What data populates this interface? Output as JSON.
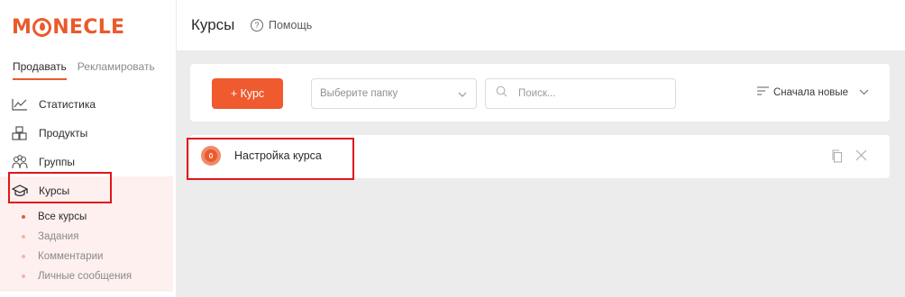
{
  "brand": {
    "logo_text": "MONECLE",
    "accent": "#ea5a2b"
  },
  "modes": [
    {
      "label": "Продавать",
      "active": true
    },
    {
      "label": "Рекламировать",
      "active": false
    }
  ],
  "sidebar": {
    "items": [
      {
        "label": "Статистика",
        "icon": "chart-line-icon"
      },
      {
        "label": "Продукты",
        "icon": "boxes-icon"
      },
      {
        "label": "Группы",
        "icon": "group-icon"
      },
      {
        "label": "Курсы",
        "icon": "graduation-cap-icon",
        "active": true
      }
    ],
    "subitems": [
      {
        "label": "Все курсы",
        "active": true
      },
      {
        "label": "Задания"
      },
      {
        "label": "Комментарии"
      },
      {
        "label": "Личные сообщения"
      }
    ]
  },
  "header": {
    "title": "Курсы",
    "help_label": "Помощь"
  },
  "toolbar": {
    "add_label": "+ Курс",
    "folder_placeholder": "Выберите папку",
    "search_placeholder": "Поиск...",
    "sort_label": "Сначала новые"
  },
  "courses": [
    {
      "name": "Настройка курса"
    }
  ]
}
